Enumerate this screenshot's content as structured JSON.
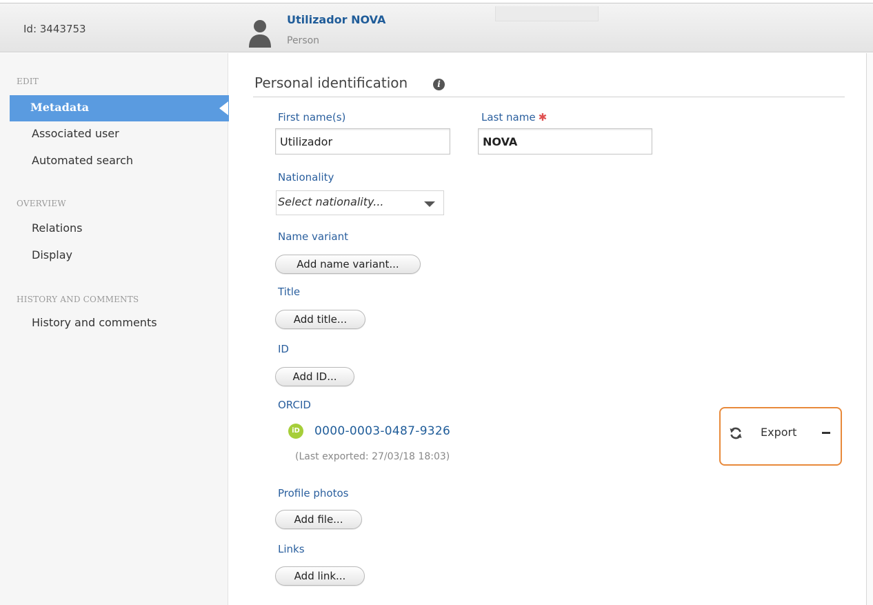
{
  "header": {
    "id_text": "Id: 3443753",
    "title": "Utilizador NOVA",
    "subtitle": "Person",
    "icon": "person-icon"
  },
  "sidebar": {
    "sections": [
      {
        "label": "EDIT",
        "items": [
          "Metadata",
          "Associated user",
          "Automated search"
        ],
        "active": "Metadata"
      },
      {
        "label": "OVERVIEW",
        "items": [
          "Relations",
          "Display"
        ]
      },
      {
        "label": "HISTORY AND COMMENTS",
        "items": [
          "History and comments"
        ]
      }
    ]
  },
  "main": {
    "section_title": "Personal identification",
    "info_icon": "i",
    "first_name": {
      "label": "First name(s)",
      "value": "Utilizador"
    },
    "last_name": {
      "label": "Last name",
      "value": "NOVA",
      "required_marker": "✱"
    },
    "nationality": {
      "label": "Nationality",
      "placeholder": "Select nationality..."
    },
    "name_variant": {
      "label": "Name variant",
      "button": "Add name variant..."
    },
    "title": {
      "label": "Title",
      "button": "Add title..."
    },
    "id": {
      "label": "ID",
      "button": "Add ID..."
    },
    "orcid": {
      "label": "ORCID",
      "icon_text": "iD",
      "value": "0000-0003-0487-9326",
      "last_exported": "(Last exported: 27/03/18 18:03)",
      "export_label": "Export",
      "refresh_icon": "refresh-icon",
      "remove_icon": "minus-icon"
    },
    "profile_photos": {
      "label": "Profile photos",
      "button": "Add file..."
    },
    "links": {
      "label": "Links",
      "button": "Add link..."
    }
  },
  "colors": {
    "accent": "#5a9be0",
    "label_blue": "#2a5f9e",
    "link_blue": "#1f5c99",
    "orcid_green": "#a6ce39",
    "highlight_orange": "#e8893a",
    "required_red": "#e05050"
  }
}
